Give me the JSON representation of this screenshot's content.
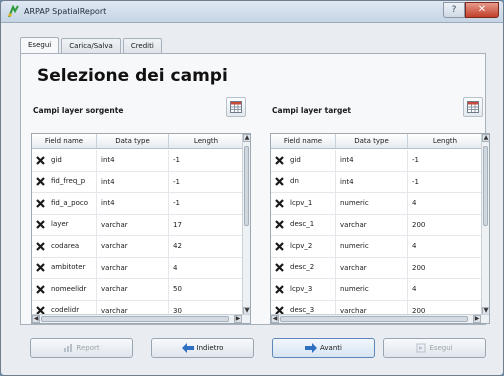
{
  "window": {
    "title": "ARPAP SpatialReport",
    "help_label": "?",
    "close_label": "✕"
  },
  "tabs": [
    {
      "label": "Esegui",
      "active": true
    },
    {
      "label": "Carica/Salva",
      "active": false
    },
    {
      "label": "Crediti",
      "active": false
    }
  ],
  "main": {
    "heading": "Selezione dei campi",
    "source_label": "Campi layer sorgente",
    "target_label": "Campi layer target"
  },
  "columns": [
    "Field name",
    "Data type",
    "Length"
  ],
  "source_rows": [
    {
      "name": "gid",
      "type": "int4",
      "length": "-1"
    },
    {
      "name": "fid_freq_p",
      "type": "int4",
      "length": "-1"
    },
    {
      "name": "fid_a_poco",
      "type": "int4",
      "length": "-1"
    },
    {
      "name": "layer",
      "type": "varchar",
      "length": "17"
    },
    {
      "name": "codarea",
      "type": "varchar",
      "length": "42"
    },
    {
      "name": "ambitoter",
      "type": "varchar",
      "length": "4"
    },
    {
      "name": "nomeelidr",
      "type": "varchar",
      "length": "50"
    },
    {
      "name": "codelidr",
      "type": "varchar",
      "length": "30"
    }
  ],
  "target_rows": [
    {
      "name": "gid",
      "type": "int4",
      "length": "-1"
    },
    {
      "name": "dn",
      "type": "int4",
      "length": "-1"
    },
    {
      "name": "lcpv_1",
      "type": "numeric",
      "length": "4"
    },
    {
      "name": "desc_1",
      "type": "varchar",
      "length": "200"
    },
    {
      "name": "lcpv_2",
      "type": "numeric",
      "length": "4"
    },
    {
      "name": "desc_2",
      "type": "varchar",
      "length": "200"
    },
    {
      "name": "lcpv_3",
      "type": "numeric",
      "length": "4"
    },
    {
      "name": "desc_3",
      "type": "varchar",
      "length": "200"
    }
  ],
  "buttons": {
    "report": "Report",
    "back": "Indietro",
    "forward": "Avanti",
    "run": "Esegui"
  },
  "colors": {
    "accent_blue": "#2e6fc2",
    "delete_icon": "#1a1a1a",
    "app_icon_green": "#2f9a3a"
  }
}
